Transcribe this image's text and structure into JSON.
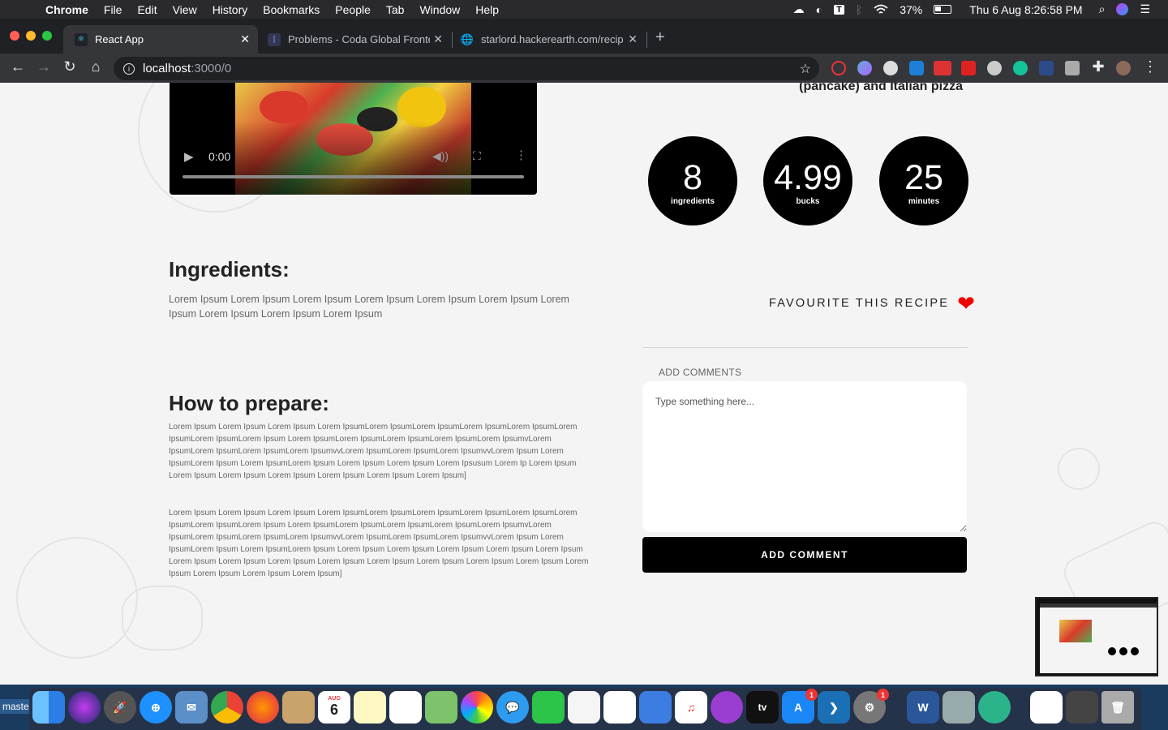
{
  "menubar": {
    "app": "Chrome",
    "items": [
      "File",
      "Edit",
      "View",
      "History",
      "Bookmarks",
      "People",
      "Tab",
      "Window",
      "Help"
    ],
    "battery": "37%",
    "datetime": "Thu 6 Aug  8:26:58 PM"
  },
  "browser": {
    "tabs": [
      {
        "title": "React App",
        "active": true
      },
      {
        "title": "Problems - Coda Global Fronte",
        "active": false
      },
      {
        "title": "starlord.hackerearth.com/recip",
        "active": false
      }
    ],
    "url_host": "localhost",
    "url_path": ":3000/0"
  },
  "recipe": {
    "subtitle_tail": "(pancake) and Italian pizza",
    "video_time": "0:00",
    "stats": [
      {
        "value": "8",
        "label": "ingredients"
      },
      {
        "value": "4.99",
        "label": "bucks"
      },
      {
        "value": "25",
        "label": "minutes"
      }
    ],
    "ingredients_heading": "Ingredients:",
    "ingredients_text": "Lorem Ipsum Lorem Ipsum Lorem Ipsum Lorem Ipsum Lorem Ipsum Lorem Ipsum Lorem Ipsum Lorem Ipsum Lorem Ipsum Lorem Ipsum",
    "prepare_heading": "How to prepare:",
    "prepare_p1": "Lorem Ipsum Lorem Ipsum Lorem Ipsum Lorem IpsumLorem IpsumLorem IpsumLorem IpsumLorem IpsumLorem IpsumLorem IpsumLorem Ipsum Lorem IpsumLorem IpsumLorem IpsumLorem IpsumLorem IpsumvLorem IpsumLorem IpsumLorem IpsumLorem IpsumvvLorem IpsumLorem IpsumLorem IpsumvvLorem Ipsum Lorem IpsumLorem Ipsum Lorem IpsumLorem Ipsum Lorem Ipsum Lorem Ipsum Lorem Ipsusum Lorem Ip Lorem Ipsum Lorem Ipsum Lorem Ipsum Lorem Ipsum Lorem Ipsum Lorem Ipsum Lorem Ipsum]",
    "prepare_p2": "Lorem Ipsum Lorem Ipsum Lorem Ipsum Lorem IpsumLorem IpsumLorem IpsumLorem IpsumLorem IpsumLorem IpsumLorem IpsumLorem Ipsum Lorem IpsumLorem IpsumLorem IpsumLorem IpsumLorem IpsumvLorem IpsumLorem IpsumLorem IpsumLorem IpsumvvLorem IpsumLorem IpsumLorem IpsumvvLorem Ipsum Lorem IpsumLorem Ipsum Lorem IpsumLorem Ipsum Lorem Ipsum Lorem Ipsum Lorem Ipsum Lorem Ipsum Lorem Ipsum Lorem Ipsum Lorem Ipsum Lorem Ipsum Lorem Ipsum Lorem Ipsum Lorem Ipsum Lorem Ipsum Lorem Ipsum Lorem Ipsum Lorem Ipsum Lorem Ipsum Lorem Ipsum]",
    "favourite_label": "FAVOURITE THIS RECIPE",
    "add_comments_label": "ADD COMMENTS",
    "comment_placeholder": "Type something here...",
    "add_comment_button": "ADD COMMENT"
  },
  "dock": {
    "branch": "maste",
    "calendar_month": "AUG",
    "calendar_day": "6",
    "appstore_badge": "1",
    "prefs_badge": "1"
  },
  "colors": {
    "page_bg": "#f4f4f4",
    "accent_black": "#000000",
    "heart": "#e00000"
  }
}
